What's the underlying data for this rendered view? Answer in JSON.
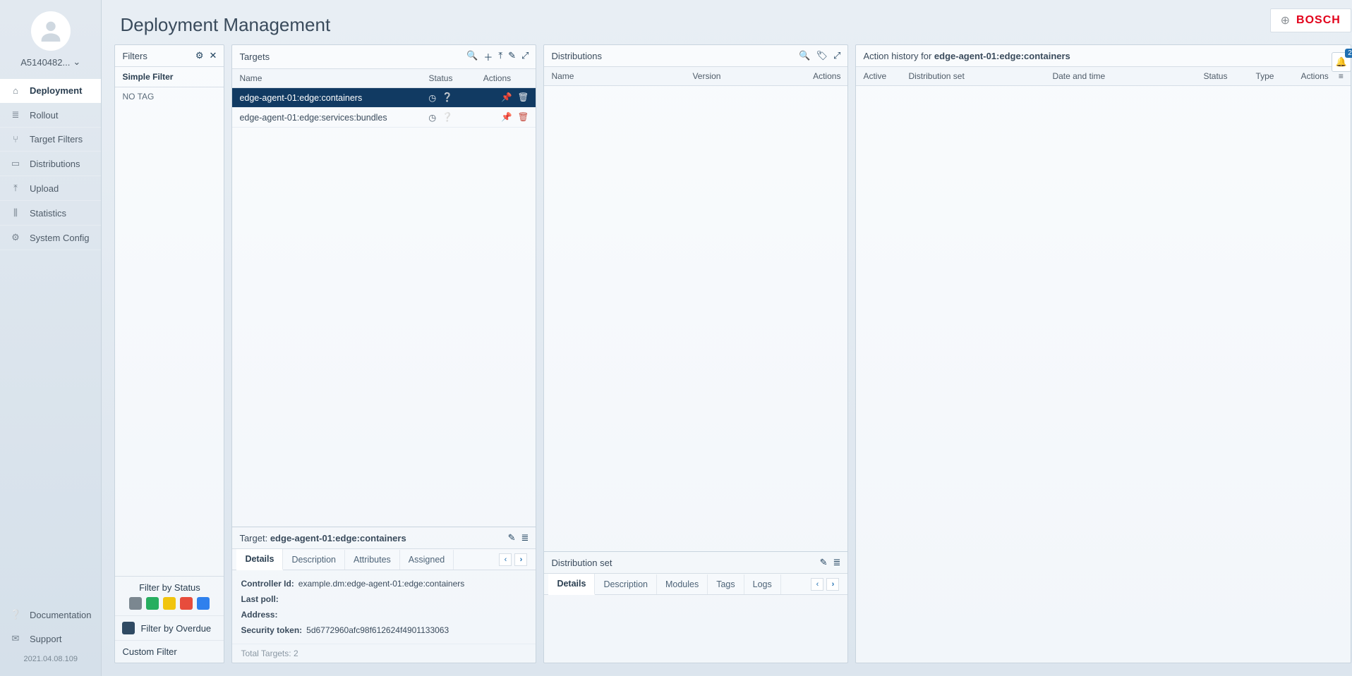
{
  "brand": {
    "name": "BOSCH"
  },
  "user": {
    "display": "A5140482..."
  },
  "page": {
    "title": "Deployment Management"
  },
  "notifications": {
    "count": "2"
  },
  "nav": {
    "items": [
      {
        "label": "Deployment"
      },
      {
        "label": "Rollout"
      },
      {
        "label": "Target Filters"
      },
      {
        "label": "Distributions"
      },
      {
        "label": "Upload"
      },
      {
        "label": "Statistics"
      },
      {
        "label": "System Config"
      }
    ],
    "bottom": [
      {
        "label": "Documentation"
      },
      {
        "label": "Support"
      }
    ],
    "version": "2021.04.08.109"
  },
  "filters": {
    "title": "Filters",
    "simple_label": "Simple Filter",
    "no_tag": "NO TAG",
    "by_status_label": "Filter by Status",
    "status_colors": [
      "#7b8790",
      "#27ae60",
      "#f1c40f",
      "#e74c3c",
      "#2f80ed"
    ],
    "overdue_label": "Filter by Overdue",
    "custom_label": "Custom Filter"
  },
  "targets": {
    "title": "Targets",
    "cols": {
      "name": "Name",
      "status": "Status",
      "actions": "Actions"
    },
    "rows": [
      {
        "name": "edge-agent-01:edge:containers",
        "selected": true
      },
      {
        "name": "edge-agent-01:edge:services:bundles",
        "selected": false
      }
    ],
    "footer": "Total Targets: 2"
  },
  "target_detail": {
    "title_prefix": "Target:",
    "title_value": "edge-agent-01:edge:containers",
    "tabs": [
      "Details",
      "Description",
      "Attributes",
      "Assigned"
    ],
    "fields": {
      "controller_id_k": "Controller Id:",
      "controller_id_v": "example.dm:edge-agent-01:edge:containers",
      "last_poll_k": "Last poll:",
      "last_poll_v": "",
      "address_k": "Address:",
      "address_v": "",
      "token_k": "Security token:",
      "token_v": "5d6772960afc98f612624f4901133063"
    }
  },
  "distributions": {
    "title": "Distributions",
    "cols": {
      "name": "Name",
      "version": "Version",
      "actions": "Actions"
    }
  },
  "dist_detail": {
    "title": "Distribution set",
    "tabs": [
      "Details",
      "Description",
      "Modules",
      "Tags",
      "Logs"
    ]
  },
  "action_history": {
    "title_prefix": "Action history for",
    "title_value": "edge-agent-01:edge:containers",
    "cols": {
      "active": "Active",
      "dist": "Distribution set",
      "date": "Date and time",
      "status": "Status",
      "type": "Type",
      "actions": "Actions"
    }
  }
}
